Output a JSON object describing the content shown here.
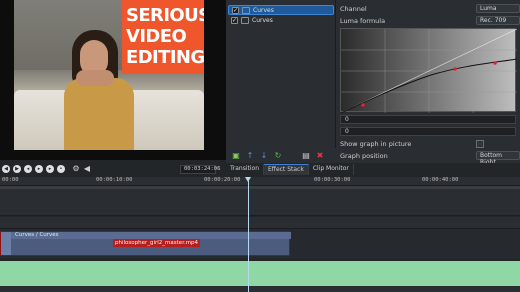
{
  "monitor": {
    "title_card": [
      "SERIOUS",
      "VIDEO",
      "EDITING"
    ],
    "timecode": "00:03:24:06"
  },
  "effect_stack": {
    "items": [
      {
        "label": "Curves",
        "checked": true,
        "selected": true
      },
      {
        "label": "Curves",
        "checked": true,
        "selected": false
      }
    ]
  },
  "settings": {
    "channel_label": "Channel",
    "channel_value": "Luma",
    "luma_formula_label": "Luma formula",
    "luma_formula_value": "Rec. 709",
    "field_x": "0",
    "field_y": "0",
    "show_graph_label": "Show graph in picture",
    "graph_position_label": "Graph position",
    "graph_position_value": "Bottom Right"
  },
  "tabs": [
    {
      "label": "Transition",
      "active": false
    },
    {
      "label": "Effect Stack",
      "active": true
    },
    {
      "label": "Clip Monitor",
      "active": false
    }
  ],
  "ruler": {
    "labels": [
      "00:00",
      "00:00:10:00",
      "00:00:20:00",
      "00:00:30:00",
      "00:00:40:00"
    ]
  },
  "timeline": {
    "clip_effect_label": "Curves / Curves",
    "clip_name": "philosopher_girl2_master.mp4"
  },
  "colors": {
    "title_card_bg": "#f0562b",
    "selection": "#1f5a9c",
    "clip_bg": "#4b5c7e",
    "clip_name_bg": "#b51f1f",
    "audio_track": "#8fd7a4"
  },
  "icons": {
    "effect_tools": [
      "add-effect-icon",
      "move-up-icon",
      "move-down-icon",
      "reset-icon",
      "save-icon",
      "delete-icon"
    ],
    "transport": [
      "rewind-icon",
      "play-backward-icon",
      "play-icon",
      "play-forward-icon",
      "forward-icon",
      "add-marker-icon",
      "volume-icon"
    ]
  }
}
